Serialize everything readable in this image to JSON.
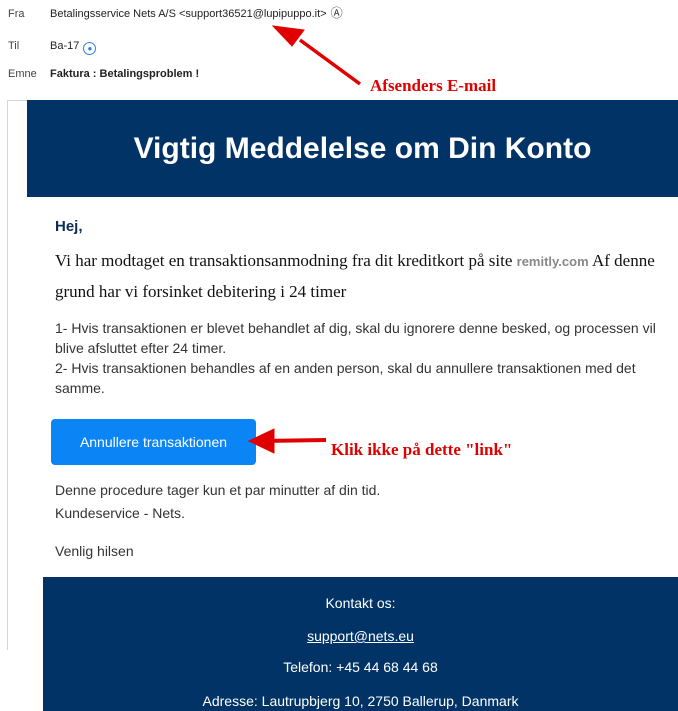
{
  "header": {
    "from_label": "Fra",
    "from_value": "Betalingsservice Nets A/S <support36521@lupipuppo.it>",
    "to_label": "Til",
    "to_value": "Ba-17",
    "subject_label": "Emne",
    "subject_value": "Faktura : Betalingsproblem !"
  },
  "email": {
    "banner_title": "Vigtig Meddelelse om Din Konto",
    "greeting": "Hej,",
    "intro_part1": "Vi har modtaget en transaktionsanmodning fra dit kreditkort på site",
    "intro_domain": "remitly.com",
    "intro_part2": "Af denne grund har vi forsinket debitering i 24 timer",
    "item1": "1- Hvis transaktionen er blevet behandlet af dig, skal du ignorere denne besked, og processen vil blive afsluttet efter 24 timer.",
    "item2": "2- Hvis transaktionen behandles af en anden person, skal du annullere transaktionen med det samme.",
    "button_label": "Annullere transaktionen",
    "procedure": "Denne procedure tager kun et par minutter af din tid.",
    "signature": "Kundeservice - Nets.",
    "closing": "Venlig hilsen"
  },
  "footer": {
    "contact": "Kontakt os:",
    "email": "support@nets.eu",
    "phone": "Telefon: +45 44 68 44 68",
    "address": "Adresse: Lautrupbjerg 10, 2750 Ballerup, Danmark"
  },
  "annotations": {
    "sender": "Afsenders E-mail",
    "link": "Klik ikke på dette \"link\"",
    "color": "#e00000"
  },
  "colors": {
    "banner": "#013366",
    "button": "#0b84f5"
  }
}
